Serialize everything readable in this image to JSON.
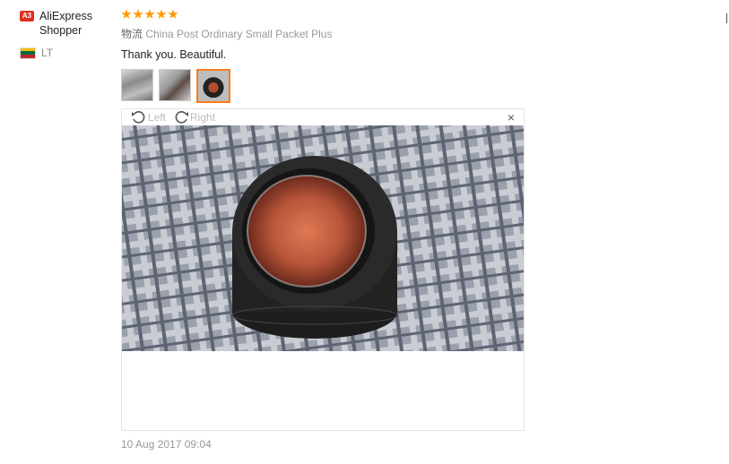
{
  "reviewer": {
    "badge": "A3",
    "name": "AliExpress Shopper",
    "country": "LT",
    "flag_colors": [
      "#fdb913",
      "#006a44",
      "#c1272d"
    ]
  },
  "review": {
    "stars": 5,
    "logistics_label": "物流",
    "logistics_value": "China Post Ordinary Small Packet Plus",
    "text": "Thank you. Beautiful.",
    "date": "10 Aug 2017 09:04"
  },
  "viewer": {
    "rotate_left_label": "Left",
    "rotate_right_label": "Right",
    "close_label": "×"
  },
  "colors": {
    "star": "#ff9a00",
    "active_thumb": "#ff7a1a",
    "badge_bg": "#e0321f"
  }
}
